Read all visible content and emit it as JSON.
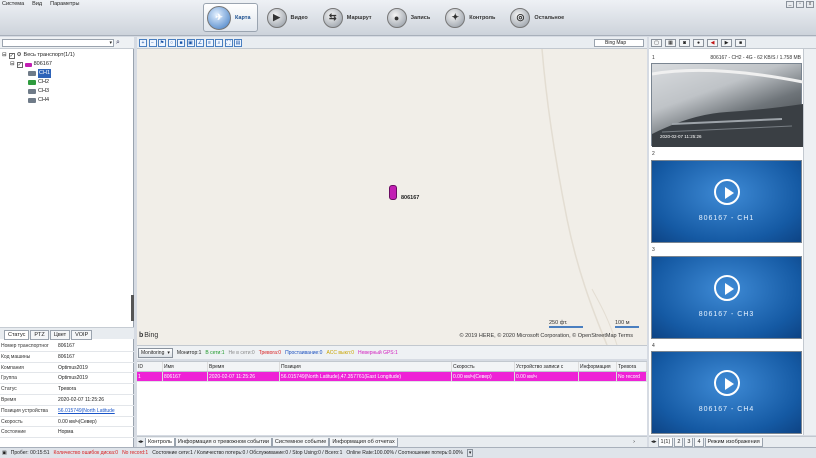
{
  "menu": [
    "Система",
    "Вид",
    "Параметры"
  ],
  "nav": [
    {
      "label": "Карта",
      "icon": "map-icon",
      "active": true
    },
    {
      "label": "Видео",
      "icon": "video-icon",
      "active": false
    },
    {
      "label": "Маршрут",
      "icon": "route-icon",
      "active": false
    },
    {
      "label": "Запись",
      "icon": "record-icon",
      "active": false
    },
    {
      "label": "Контроль",
      "icon": "control-icon",
      "active": false
    },
    {
      "label": "Остальное",
      "icon": "other-icon",
      "active": false
    }
  ],
  "tree": {
    "root": "Весь транспорт(1/1)",
    "vehicle": "806167",
    "channels": [
      "CH1",
      "CH2",
      "CH3",
      "CH4"
    ]
  },
  "left_tabs": [
    "Статус",
    "PTZ",
    "Цвет",
    "VOIP"
  ],
  "info": [
    {
      "k": "Номер транспортног",
      "v": "806167"
    },
    {
      "k": "Код машины",
      "v": "806167"
    },
    {
      "k": "Компания",
      "v": "Optimus2019"
    },
    {
      "k": "Группа",
      "v": "Optimus2019"
    },
    {
      "k": "Статус",
      "v": "Тревога"
    },
    {
      "k": "Время",
      "v": "2020-02-07 11:25:26"
    },
    {
      "k": "Позиция устройства",
      "v": "56.015749(North Latitude"
    },
    {
      "k": "Скорость",
      "v": "0.00 км/ч(Север)"
    },
    {
      "k": "Состояние",
      "v": "Норма"
    }
  ],
  "map": {
    "provider_select": "Bing Map",
    "vehicle_label": "806167",
    "brand": "Bing",
    "copyright": "© 2019 HERE, © 2020 Microsoft Corporation, © OpenStreetMap  Terms",
    "scale_ft": "250 фт.",
    "scale_m": "100 м"
  },
  "monitor": {
    "select": "Monitoring",
    "counters": [
      {
        "label": "Монитор:1",
        "color": "#222222"
      },
      {
        "label": "В сети:1",
        "color": "#1e9a2a"
      },
      {
        "label": "Не в сети:0",
        "color": "#8a8a8a"
      },
      {
        "label": "Тревога:0",
        "color": "#d81d1d"
      },
      {
        "label": "Простаивание:0",
        "color": "#1a4fbf"
      },
      {
        "label": "ACC выкл:0",
        "color": "#c9a400"
      },
      {
        "label": "Неверный GPS:1",
        "color": "#d21dbf"
      }
    ]
  },
  "grid": {
    "headers": [
      "ID",
      "Имя",
      "Время",
      "Позиция",
      "Скорость",
      "Устройство записи с",
      "Информация",
      "Тревога"
    ],
    "rows": [
      [
        "1",
        "806167",
        "2020-02-07 11:25:26",
        "56.015749(North Latitude),47.357761(East Longitude)",
        "0.00 км/ч(Север)",
        "0.00 км/ч",
        "",
        "No record"
      ]
    ]
  },
  "bottom_tabs": [
    "Контроль",
    "Информация о тревожном событии",
    "Системное событие",
    "Информация об отчетах"
  ],
  "video": {
    "slots": [
      {
        "num": "1",
        "title": "806167 - CH2 - 4G - 62 KB/S / 1.758 MB",
        "caption": ""
      },
      {
        "num": "2",
        "title": "",
        "caption": "806167 - CH1"
      },
      {
        "num": "3",
        "title": "",
        "caption": "806167 - CH3"
      },
      {
        "num": "4",
        "title": "",
        "caption": "806167 - CH4"
      }
    ],
    "cam_overlay": "2020-02-07 11:25:26",
    "tabs": [
      "1(1)",
      "2",
      "3",
      "4",
      "Режим изображения"
    ]
  },
  "status": [
    {
      "label": "Пробег: 00:15:51",
      "color": "#222222"
    },
    {
      "label": "Количество ошибок диска:0",
      "color": "#d81d1d"
    },
    {
      "label": "No record:1",
      "color": "#d81d1d"
    },
    {
      "label": "Состояние сети:1 / Количество потерь:0 / Обслуживание:0 / Stop Using:0 / Всего:1",
      "color": "#222222"
    },
    {
      "label": "Online Rate:100.00% / Соотношение потерь:0.00%",
      "color": "#222222"
    }
  ]
}
